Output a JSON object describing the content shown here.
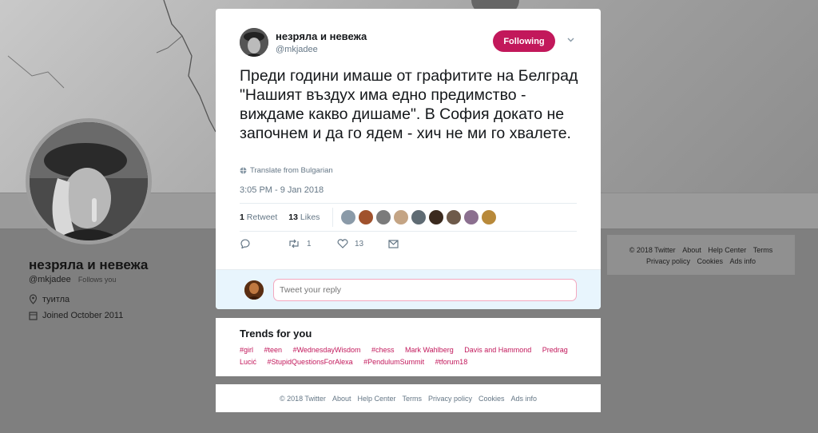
{
  "profile": {
    "name": "незряла и невежа",
    "handle": "@mkjadee",
    "follows_you": "Follows you",
    "location": "туитла",
    "joined": "Joined October 2011"
  },
  "tweet": {
    "author_name": "незряла и невежа",
    "author_handle": "@mkjadee",
    "follow_label": "Following",
    "text": "Преди години имаше от графитите на Белград \"Нашият въздух има едно предимство - виждаме какво дишаме\". В София докато не започнем и да го ядем - хич не ми го хвалете.",
    "translate_label": "Translate from Bulgarian",
    "timestamp": "3:05 PM - 9 Jan 2018",
    "retweet_count": "1",
    "retweet_label": "Retweet",
    "like_count": "13",
    "like_label": "Likes",
    "action_retweet_count": "1",
    "action_like_count": "13",
    "reply_placeholder": "Tweet your reply",
    "likers": [
      "#8a9aa8",
      "#a0522d",
      "#7b7b7b",
      "#c4a484",
      "#5f6b73",
      "#3b2a1e",
      "#6e5a4a",
      "#8b6f8f",
      "#b8893a"
    ]
  },
  "trends": {
    "title": "Trends for you",
    "items": [
      "#girl",
      "#teen",
      "#WednesdayWisdom",
      "#chess",
      "Mark Wahlberg",
      "Davis and Hammond",
      "Predrag",
      "Lucić",
      "#StupidQuestionsForAlexa",
      "#PendulumSummit",
      "#tforum18"
    ]
  },
  "footer": {
    "items": [
      "© 2018 Twitter",
      "About",
      "Help Center",
      "Terms",
      "Privacy policy",
      "Cookies",
      "Ads info"
    ]
  },
  "side_footer": {
    "line1": [
      "© 2018 Twitter",
      "About",
      "Help Center",
      "Terms"
    ],
    "line2": [
      "Privacy policy",
      "Cookies",
      "Ads info"
    ]
  },
  "colors": {
    "accent": "#c2185b",
    "text": "#14171a",
    "muted": "#657786"
  }
}
